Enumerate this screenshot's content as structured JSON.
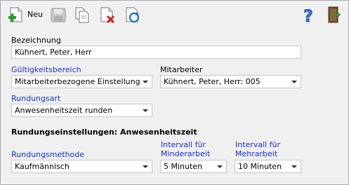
{
  "toolbar": {
    "new_label": "Neu"
  },
  "fields": {
    "bezeichnung": {
      "label": "Bezeichnung",
      "value": "Kühnert, Peter, Herr"
    },
    "gueltigkeitsbereich": {
      "label": "Gültigkeitsbereich",
      "value": "Mitarbeiterbezogene Einstellung"
    },
    "mitarbeiter": {
      "label": "Mitarbeiter",
      "value": "Kühnert, Peter, Herr: 005"
    },
    "rundungsart": {
      "label": "Rundungsart",
      "value": "Anwesenheitszeit runden"
    }
  },
  "section": {
    "title": "Rundungseinstellungen: Anwesenheitszeit"
  },
  "rounding": {
    "methode": {
      "label": "Rundungsmethode",
      "value": "Kaufmännisch"
    },
    "minder": {
      "label_line1": "Intervall für",
      "label_line2": "Minderarbeit",
      "value": "5 Minuten"
    },
    "mehr": {
      "label_line1": "Intervall für",
      "label_line2": "Mehrarbeit",
      "value": "10 Minuten"
    }
  },
  "colors": {
    "accent_label": "#1530d8",
    "frame_bg": "#f0f0f0"
  },
  "icons": [
    "new-document-icon",
    "save-icon",
    "copy-icon",
    "delete-icon",
    "refresh-icon",
    "help-icon",
    "exit-icon"
  ]
}
